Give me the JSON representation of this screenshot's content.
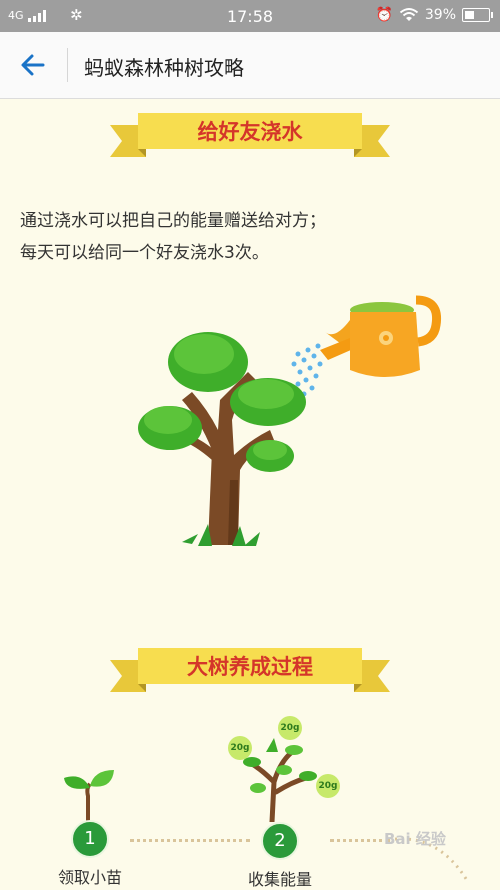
{
  "status_bar": {
    "network": "4G",
    "time": "17:58",
    "battery": "39%",
    "icons": [
      "signal-icon",
      "settings-gear-icon",
      "alarm-icon",
      "wifi-icon",
      "battery-icon"
    ]
  },
  "nav": {
    "back_icon": "back-arrow-icon",
    "title": "蚂蚁森林种树攻略"
  },
  "section1": {
    "heading": "给好友浇水",
    "lines": [
      "通过浇水可以把自己的能量赠送给对方；",
      "每天可以给同一个好友浇水3次。"
    ]
  },
  "section2": {
    "heading": "大树养成过程",
    "steps": [
      {
        "number": "1",
        "caption": "领取小苗"
      },
      {
        "number": "2",
        "caption": "收集能量"
      }
    ],
    "energy_badges": [
      "20g",
      "20g",
      "20g"
    ]
  },
  "watermark": "Bai 经验",
  "colors": {
    "background": "#fdfbea",
    "status_bar": "#9e9e9e",
    "accent_blue": "#1a73c7",
    "ribbon_yellow": "#f7dd4f",
    "heading_red": "#d4352a",
    "step_green": "#2a9a3a"
  }
}
